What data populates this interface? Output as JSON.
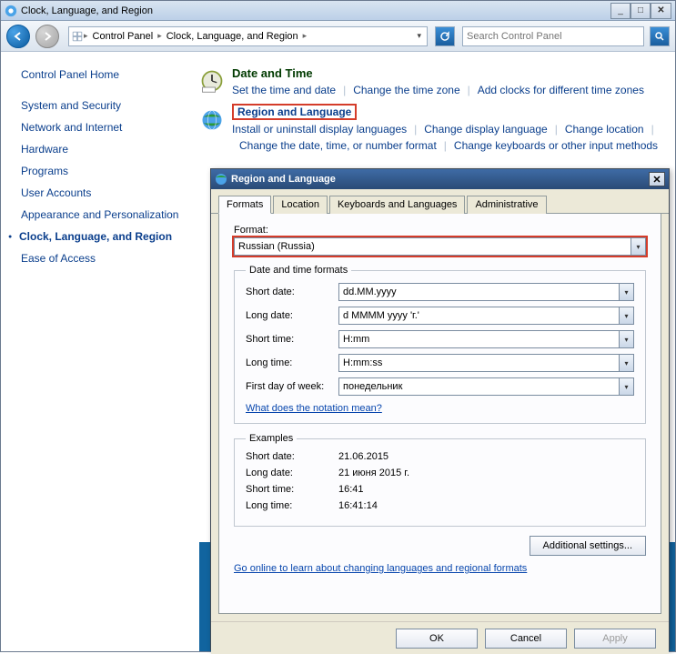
{
  "window": {
    "title": "Clock, Language, and Region"
  },
  "nav": {
    "breadcrumb": {
      "root": "Control Panel",
      "current": "Clock, Language, and Region"
    },
    "search_placeholder": "Search Control Panel"
  },
  "sidebar": {
    "items": [
      "Control Panel Home",
      "System and Security",
      "Network and Internet",
      "Hardware",
      "Programs",
      "User Accounts",
      "Appearance and Personalization",
      "Clock, Language, and Region",
      "Ease of Access"
    ],
    "active_index": 7
  },
  "categories": {
    "datetime": {
      "title": "Date and Time",
      "links": [
        "Set the time and date",
        "Change the time zone",
        "Add clocks for different time zones"
      ]
    },
    "region": {
      "title": "Region and Language",
      "links": [
        "Install or uninstall display languages",
        "Change display language",
        "Change location",
        "Change the date, time, or number format",
        "Change keyboards or other input methods"
      ]
    }
  },
  "dialog": {
    "title": "Region and Language",
    "tabs": [
      "Formats",
      "Location",
      "Keyboards and Languages",
      "Administrative"
    ],
    "active_tab": 0,
    "format_label": "Format:",
    "format_value": "Russian (Russia)",
    "dtf_legend": "Date and time formats",
    "rows": {
      "short_date": {
        "label": "Short date:",
        "value": "dd.MM.yyyy"
      },
      "long_date": {
        "label": "Long date:",
        "value": "d MMMM yyyy 'г.'"
      },
      "short_time": {
        "label": "Short time:",
        "value": "H:mm"
      },
      "long_time": {
        "label": "Long time:",
        "value": "H:mm:ss"
      },
      "first_day": {
        "label": "First day of week:",
        "value": "понедельник"
      }
    },
    "notation_link": "What does the notation mean?",
    "examples_legend": "Examples",
    "examples": {
      "short_date": {
        "label": "Short date:",
        "value": "21.06.2015"
      },
      "long_date": {
        "label": "Long date:",
        "value": "21 июня 2015 г."
      },
      "short_time": {
        "label": "Short time:",
        "value": "16:41"
      },
      "long_time": {
        "label": "Long time:",
        "value": "16:41:14"
      }
    },
    "additional_btn": "Additional settings...",
    "online_link": "Go online to learn about changing languages and regional formats",
    "buttons": {
      "ok": "OK",
      "cancel": "Cancel",
      "apply": "Apply"
    }
  }
}
